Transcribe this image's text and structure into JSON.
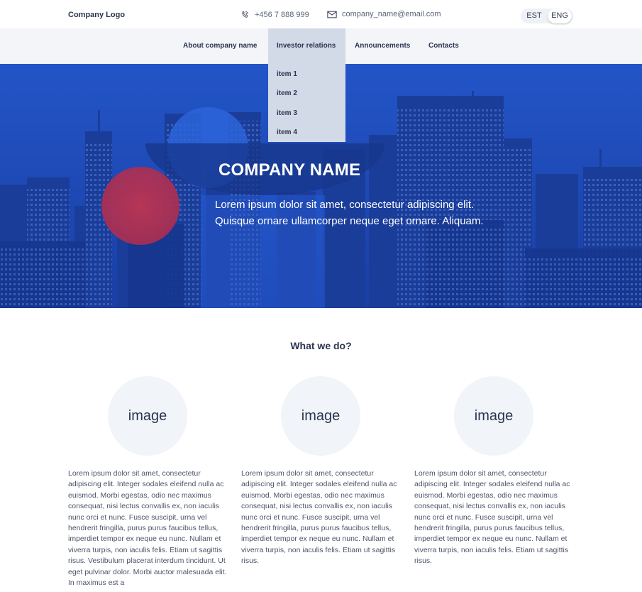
{
  "header": {
    "logo": "Company Logo",
    "phone": "+456 7 888 999",
    "email": "company_name@email.com",
    "languages": [
      "EST",
      "ENG"
    ],
    "active_language": "ENG"
  },
  "nav": {
    "items": [
      "About company name",
      "Investor relations",
      "Announcements",
      "Contacts"
    ],
    "active": "Investor relations",
    "dropdown": [
      "item 1",
      "item 2",
      "item 3",
      "item 4"
    ]
  },
  "hero": {
    "title": "COMPANY NAME",
    "subtitle_line1": "Lorem ipsum dolor sit amet, consectetur adipiscing elit.",
    "subtitle_line2": "Quisque ornare ullamcorper neque eget ornare. Aliquam."
  },
  "section": {
    "title": "What we do?",
    "columns": [
      {
        "image_label": "image",
        "text": "Lorem ipsum dolor sit amet, consectetur adipiscing elit. Integer sodales eleifend nulla ac euismod. Morbi egestas, odio nec maximus consequat, nisi lectus convallis ex, non iaculis nunc orci et nunc. Fusce suscipit, urna vel hendrerit fringilla, purus purus faucibus tellus, imperdiet tempor ex neque eu nunc. Nullam et viverra turpis, non iaculis felis. Etiam ut sagittis risus. Vestibulum placerat interdum tincidunt. Ut eget pulvinar dolor. Morbi auctor malesuada elit. In maximus est a"
      },
      {
        "image_label": "image",
        "text": "Lorem ipsum dolor sit amet, consectetur adipiscing elit. Integer sodales eleifend nulla ac euismod. Morbi egestas, odio nec maximus consequat, nisi lectus convallis ex, non iaculis nunc orci et nunc. Fusce suscipit, urna vel hendrerit fringilla, purus purus faucibus tellus, imperdiet tempor ex neque eu nunc. Nullam et viverra turpis, non iaculis felis. Etiam ut sagittis risus."
      },
      {
        "image_label": "image",
        "text": "Lorem ipsum dolor sit amet, consectetur adipiscing elit. Integer sodales eleifend nulla ac euismod. Morbi egestas, odio nec maximus consequat, nisi lectus convallis ex, non iaculis nunc orci et nunc. Fusce suscipit, urna vel hendrerit fringilla, purus purus faucibus tellus, imperdiet tempor ex neque eu nunc. Nullam et viverra turpis, non iaculis felis. Etiam ut sagittis risus."
      }
    ]
  },
  "colors": {
    "hero_blue": "#1b46b8",
    "nav_bg": "#f3f5f9",
    "dropdown_bg": "#d2dae8",
    "accent_red": "#e0303a",
    "text_dark": "#2b3550"
  }
}
